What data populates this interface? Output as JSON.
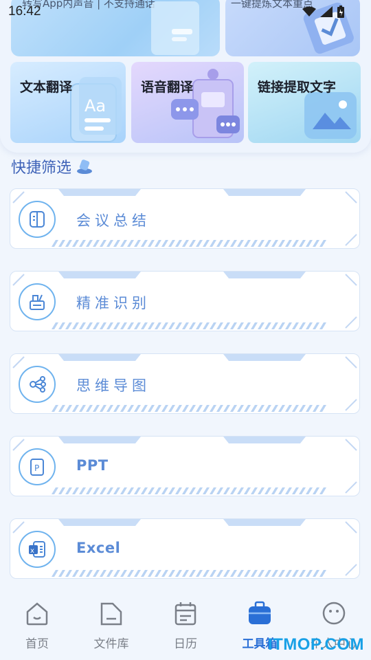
{
  "status_bar": {
    "time": "16:42"
  },
  "top_cards": {
    "left_subtitle": "转写App内声音 | 不支持通话",
    "right_subtitle": "一键提炼文本重点"
  },
  "tools": [
    {
      "label": "文本翻译",
      "icon": "document-aa-icon"
    },
    {
      "label": "语音翻译",
      "icon": "chat-bubbles-icon"
    },
    {
      "label": "链接提取文字",
      "icon": "image-icon"
    }
  ],
  "section": {
    "title": "快捷筛选"
  },
  "filters": [
    {
      "label": "会议总结",
      "icon": "book-icon"
    },
    {
      "label": "精准识别",
      "icon": "basket-icon"
    },
    {
      "label": "思维导图",
      "icon": "mindmap-icon"
    },
    {
      "label": "PPT",
      "icon": "ppt-icon"
    },
    {
      "label": "Excel",
      "icon": "excel-icon"
    }
  ],
  "nav": [
    {
      "label": "首页",
      "icon": "home-icon"
    },
    {
      "label": "文件库",
      "icon": "folder-icon"
    },
    {
      "label": "日历",
      "icon": "calendar-icon"
    },
    {
      "label": "工具箱",
      "icon": "toolbox-icon",
      "active": true
    },
    {
      "label": "个人中心",
      "icon": "smile-icon"
    }
  ],
  "watermark": "ITMOP.COM",
  "colors": {
    "accent": "#2a6fd6",
    "card_label": "#5b8bd6",
    "ring": "#6fb3ee",
    "section_title": "#3f63b8"
  }
}
